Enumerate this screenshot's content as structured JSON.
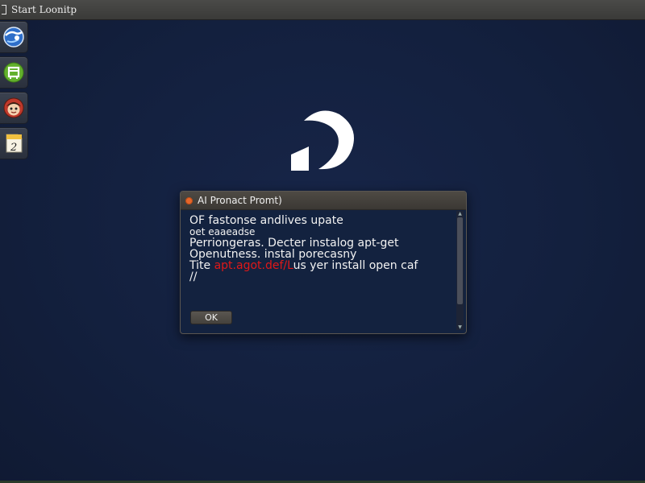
{
  "topbar": {
    "title": "Start Loonitp",
    "menu_icon": "menu-bracket-icon"
  },
  "dock": {
    "items": [
      {
        "icon": "browser-globe-icon",
        "color": "#3a7bd5"
      },
      {
        "icon": "green-app-icon",
        "color": "#6ab32e"
      },
      {
        "icon": "character-face-icon",
        "color": "#b83a2a"
      },
      {
        "icon": "calendar-document-icon",
        "color": "#f0c040",
        "label": "2"
      }
    ]
  },
  "logo": {
    "icon": "distro-logo-icon",
    "color": "#ffffff"
  },
  "dialog": {
    "title": "AI Pronact Promt)",
    "close_color": "#e5662a",
    "lines": [
      "OF fastonse andlives upate",
      "oet eaaeadse",
      "Perriongeras. Decter instalog apt-get",
      "Openutness. instal porecasny",
      "Tite ",
      "apt.agot.def/L",
      "us yer install open caf",
      "//"
    ],
    "ok_label": "OK"
  },
  "colors": {
    "background": "#14213d",
    "highlight_red": "#e01818"
  }
}
